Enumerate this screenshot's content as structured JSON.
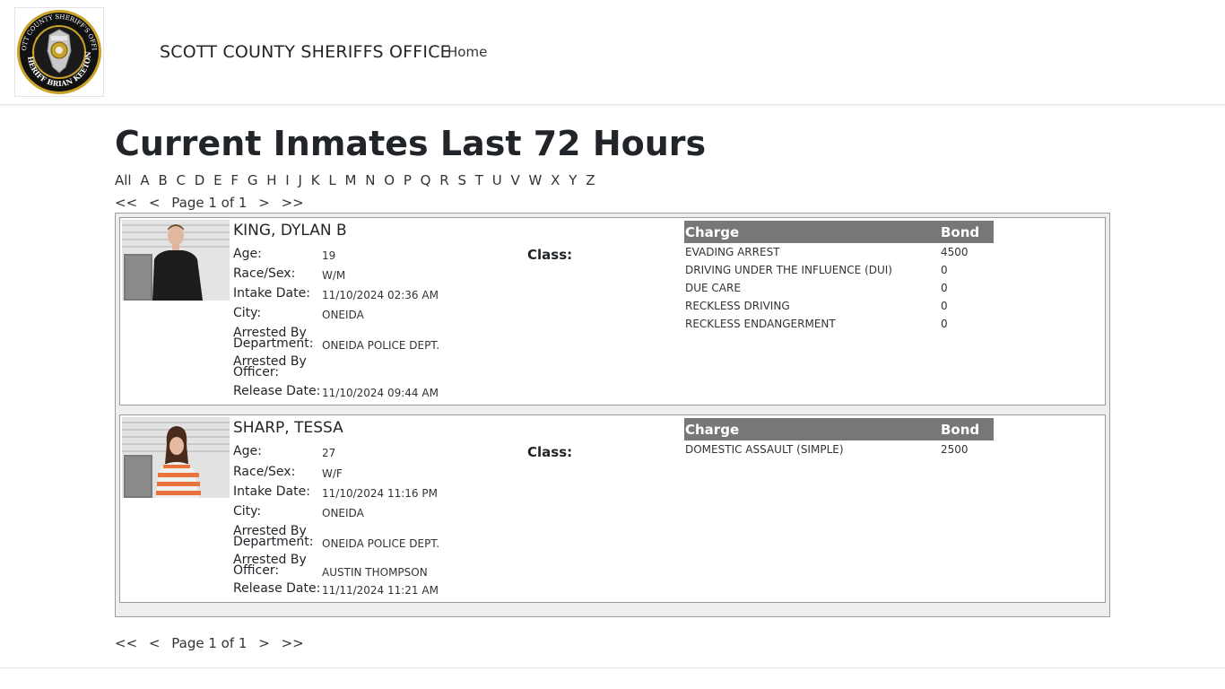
{
  "header": {
    "brand": "SCOTT COUNTY SHERIFFS OFFICE",
    "nav_home": "Home",
    "logo_text_top": "SCOTT COUNTY SHERIFF'S OFFICE",
    "logo_text_bottom": "SHERIFF BRIAN KEETON"
  },
  "page": {
    "title": "Current Inmates Last 72 Hours"
  },
  "alphabet": [
    "All",
    "A",
    "B",
    "C",
    "D",
    "E",
    "F",
    "G",
    "H",
    "I",
    "J",
    "K",
    "L",
    "M",
    "N",
    "O",
    "P",
    "Q",
    "R",
    "S",
    "T",
    "U",
    "V",
    "W",
    "X",
    "Y",
    "Z"
  ],
  "pager": {
    "first": "<<",
    "prev": "<",
    "text": "Page 1 of 1",
    "next": ">",
    "last": ">>"
  },
  "labels": {
    "age": "Age:",
    "class": "Class:",
    "race_sex": "Race/Sex:",
    "intake_date": "Intake Date:",
    "city": "City:",
    "arrested_by_department_1": "Arrested By",
    "arrested_by_department_2": "Department:",
    "arrested_by_officer_1": "Arrested By",
    "arrested_by_officer_2": "Officer:",
    "release_date": "Release Date:",
    "charge": "Charge",
    "bond": "Bond"
  },
  "inmates": [
    {
      "name": "KING, DYLAN B",
      "age": "19",
      "class": "",
      "race_sex": "W/M",
      "intake_date": "11/10/2024 02:36 AM",
      "city": "ONEIDA",
      "department": "ONEIDA POLICE DEPT.",
      "officer": "",
      "release_date": "11/10/2024 09:44 AM",
      "charges": [
        {
          "charge": "EVADING ARREST",
          "bond": "4500"
        },
        {
          "charge": "DRIVING UNDER THE INFLUENCE (DUI)",
          "bond": "0"
        },
        {
          "charge": "DUE CARE",
          "bond": "0"
        },
        {
          "charge": "RECKLESS DRIVING",
          "bond": "0"
        },
        {
          "charge": "RECKLESS ENDANGERMENT",
          "bond": "0"
        }
      ]
    },
    {
      "name": "SHARP, TESSA",
      "age": "27",
      "class": "",
      "race_sex": "W/F",
      "intake_date": "11/10/2024 11:16 PM",
      "city": "ONEIDA",
      "department": "ONEIDA POLICE DEPT.",
      "officer": "AUSTIN THOMPSON",
      "release_date": "11/11/2024 11:21 AM",
      "charges": [
        {
          "charge": "DOMESTIC ASSAULT (SIMPLE)",
          "bond": "2500"
        }
      ]
    }
  ],
  "colors": {
    "charge_header_bg": "#777777",
    "outer_bg": "#eeeeee"
  }
}
